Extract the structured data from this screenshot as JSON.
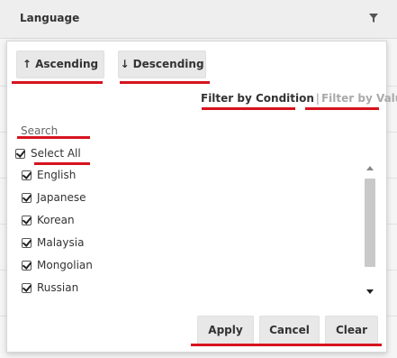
{
  "header": {
    "column_title": "Language",
    "filter_icon": "funnel-icon"
  },
  "sort": {
    "ascending_label": "↑ Ascending",
    "descending_label": "↓ Descending"
  },
  "filter_mode": {
    "by_condition_label": "Filter by Condition",
    "separator": "|",
    "by_value_label": "Filter by Value"
  },
  "search": {
    "placeholder": "Search",
    "value": ""
  },
  "select_all": {
    "label": "Select All",
    "checked": true
  },
  "items": [
    {
      "label": "English",
      "checked": true
    },
    {
      "label": "Japanese",
      "checked": true
    },
    {
      "label": "Korean",
      "checked": true
    },
    {
      "label": "Malaysia",
      "checked": true
    },
    {
      "label": "Mongolian",
      "checked": true
    },
    {
      "label": "Russian",
      "checked": true
    }
  ],
  "actions": {
    "apply_label": "Apply",
    "cancel_label": "Cancel",
    "clear_label": "Clear"
  },
  "colors": {
    "highlight_underline": "#d6131f",
    "button_bg": "#e8e8e8",
    "panel_bg": "#ffffff"
  }
}
